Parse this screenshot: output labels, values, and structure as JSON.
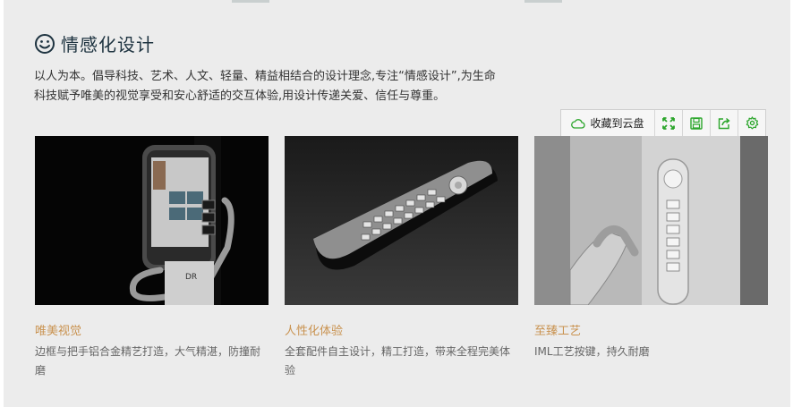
{
  "section": {
    "title": "情感化设计",
    "description_line1": "以人为本。倡导科技、艺术、人文、轻量、精益相结合的设计理念,专注“情感设计”,为生命",
    "description_line2": "科技赋予唯美的视觉享受和安心舒适的交互体验,用设计传递关爱、信任与尊重。"
  },
  "toolbar": {
    "save_label": "收藏到云盘",
    "icons": [
      "cloud-icon",
      "expand-icon",
      "save-icon",
      "share-icon",
      "gear-icon"
    ],
    "accent": "#2aa52a"
  },
  "cards": [
    {
      "title": "唯美视觉",
      "desc": "边框与把手铝合金精艺打造，大气精湛，防撞耐磨",
      "image_text": "DR"
    },
    {
      "title": "人性化体验",
      "desc": "全套配件自主设计，精工打造，带来全程完美体验"
    },
    {
      "title": "至臻工艺",
      "desc": "IML工艺按键，持久耐磨"
    }
  ],
  "colors": {
    "card_title": "#c9924f",
    "heading": "#1e3340",
    "background": "#ececec"
  }
}
